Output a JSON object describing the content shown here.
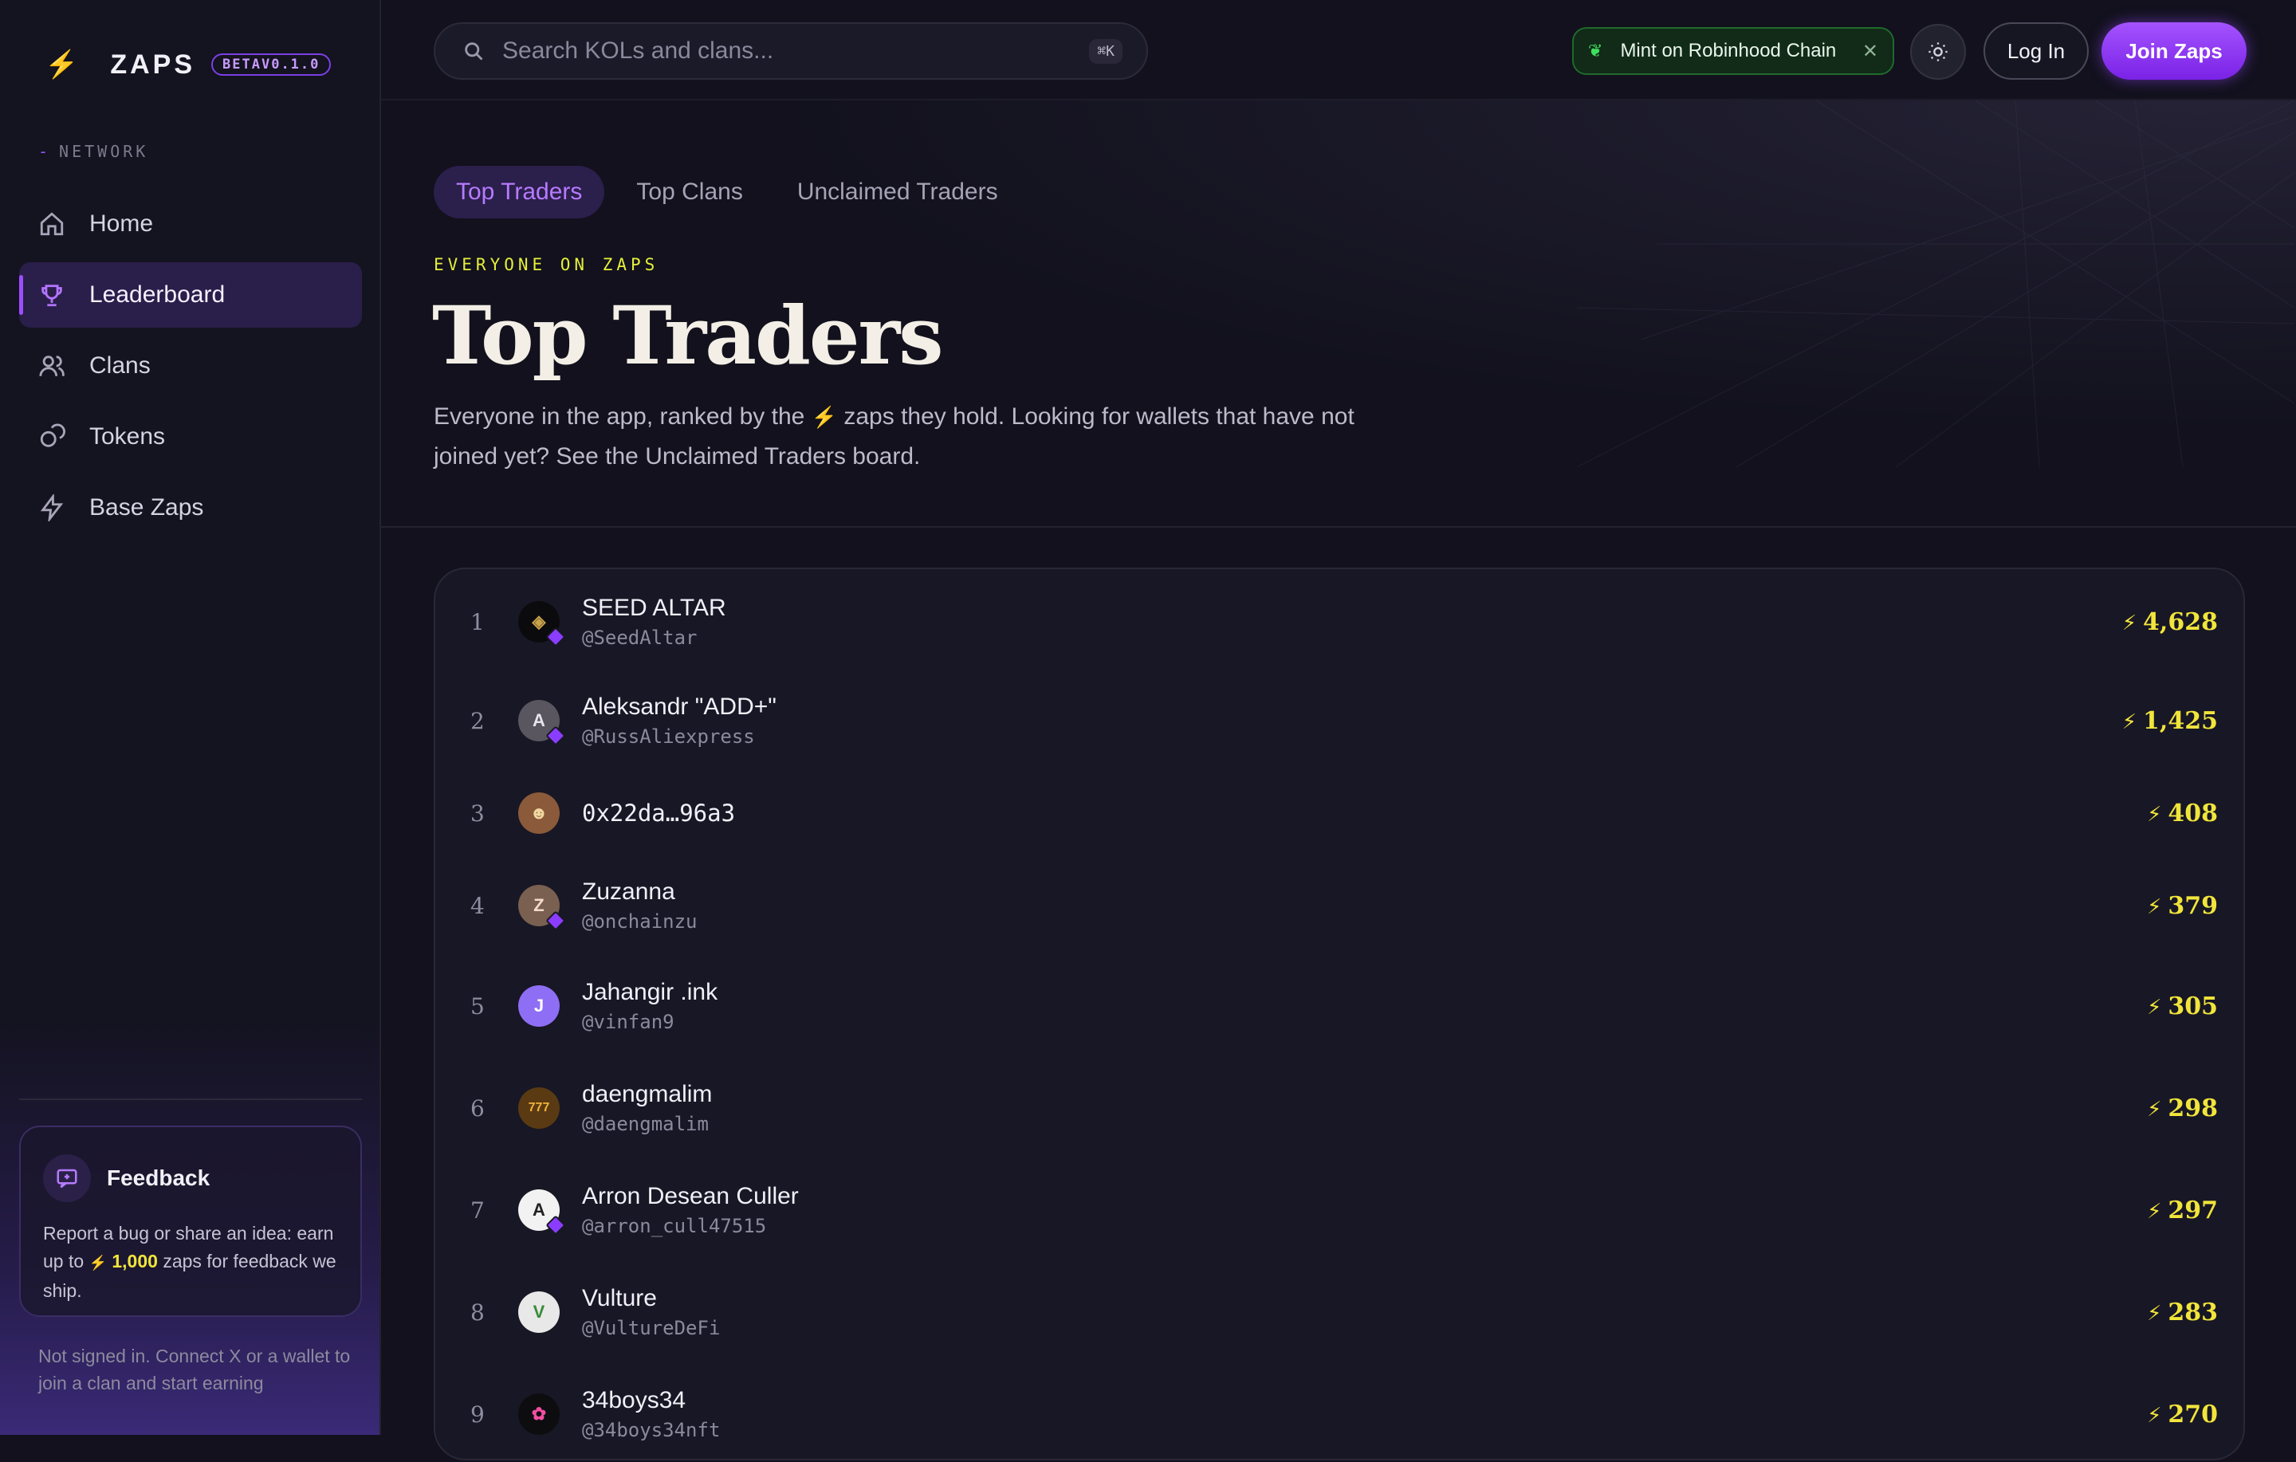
{
  "brand": {
    "name": "ZAPS",
    "badge": "BETAV0.1.0"
  },
  "sidebar": {
    "section_label": "NETWORK",
    "items": [
      {
        "label": "Home",
        "icon": "home-icon",
        "active": false
      },
      {
        "label": "Leaderboard",
        "icon": "trophy-icon",
        "active": true
      },
      {
        "label": "Clans",
        "icon": "users-icon",
        "active": false
      },
      {
        "label": "Tokens",
        "icon": "coins-icon",
        "active": false
      },
      {
        "label": "Base Zaps",
        "icon": "bolt-icon",
        "active": false
      }
    ],
    "feedback": {
      "title": "Feedback",
      "text_before": "Report a bug or share an idea: earn up to",
      "amount": "1,000",
      "text_after": "zaps for feedback we ship."
    },
    "status": "Not signed in. Connect X or a wallet to join a clan and start earning"
  },
  "header": {
    "search_placeholder": "Search KOLs and clans...",
    "search_shortcut": "⌘K",
    "mint_banner": "Mint on Robinhood Chain",
    "login_label": "Log In",
    "join_label": "Join Zaps"
  },
  "tabs": [
    {
      "label": "Top Traders",
      "active": true
    },
    {
      "label": "Top Clans",
      "active": false
    },
    {
      "label": "Unclaimed Traders",
      "active": false
    }
  ],
  "hero": {
    "eyebrow": "EVERYONE ON ZAPS",
    "title": "Top Traders",
    "desc_before": "Everyone in the app, ranked by the",
    "desc_after": "zaps they hold. Looking for wallets that have not joined yet? See the Unclaimed Traders board."
  },
  "leaderboard": [
    {
      "rank": "1",
      "name": "SEED ALTAR",
      "handle": "@SeedAltar",
      "zaps": "4,628",
      "verified": true,
      "avatar_bg": "#0b0b0e",
      "avatar_fg": "#c9a24a",
      "avatar_glyph": "◈"
    },
    {
      "rank": "2",
      "name": "Aleksandr \"ADD+\"",
      "handle": "@RussAliexpress",
      "zaps": "1,425",
      "verified": true,
      "avatar_bg": "#5a5660",
      "avatar_fg": "#e8e4ea",
      "avatar_glyph": "A"
    },
    {
      "rank": "3",
      "name": "0x22da…96a3",
      "handle": "",
      "zaps": "408",
      "verified": false,
      "avatar_bg": "#8a5a3a",
      "avatar_fg": "#f0d8a0",
      "avatar_glyph": "☻"
    },
    {
      "rank": "4",
      "name": "Zuzanna",
      "handle": "@onchainzu",
      "zaps": "379",
      "verified": true,
      "avatar_bg": "#7a6050",
      "avatar_fg": "#f1dccb",
      "avatar_glyph": "Z"
    },
    {
      "rank": "5",
      "name": "Jahangir .ink",
      "handle": "@vinfan9",
      "zaps": "305",
      "verified": false,
      "avatar_bg": "#8e6ef5",
      "avatar_fg": "#ffffff",
      "avatar_glyph": "J"
    },
    {
      "rank": "6",
      "name": "daengmalim",
      "handle": "@daengmalim",
      "zaps": "298",
      "verified": false,
      "avatar_bg": "#5a3a12",
      "avatar_fg": "#f0b23a",
      "avatar_glyph": "777"
    },
    {
      "rank": "7",
      "name": "Arron Desean Culler",
      "handle": "@arron_cull47515",
      "zaps": "297",
      "verified": true,
      "avatar_bg": "#f2f2f2",
      "avatar_fg": "#222222",
      "avatar_glyph": "A"
    },
    {
      "rank": "8",
      "name": "Vulture",
      "handle": "@VultureDeFi",
      "zaps": "283",
      "verified": false,
      "avatar_bg": "#e8e8e8",
      "avatar_fg": "#3a8a3a",
      "avatar_glyph": "V"
    },
    {
      "rank": "9",
      "name": "34boys34",
      "handle": "@34boys34nft",
      "zaps": "270",
      "verified": false,
      "avatar_bg": "#0d0d10",
      "avatar_fg": "#f04fa0",
      "avatar_glyph": "✿"
    }
  ]
}
